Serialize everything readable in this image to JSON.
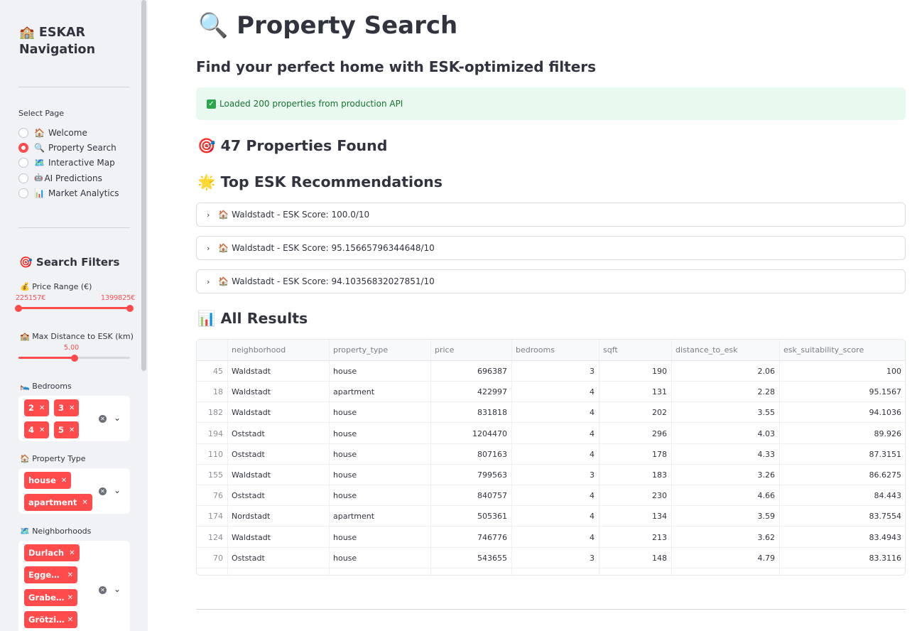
{
  "sidebar": {
    "title_line1": "🏫 ESKAR",
    "title_line2": "Navigation",
    "select_page_label": "Select Page",
    "pages": [
      {
        "icon": "🏠",
        "label": "Welcome",
        "selected": false
      },
      {
        "icon": "🔍",
        "label": "Property Search",
        "selected": true
      },
      {
        "icon": "🗺️",
        "label": "Interactive Map",
        "selected": false
      },
      {
        "icon": "🤖",
        "label": "AI Predictions",
        "selected": false
      },
      {
        "icon": "📊",
        "label": "Market Analytics",
        "selected": false
      }
    ],
    "filters_heading": "🎯 Search Filters",
    "price_label": "💰 Price Range (€)",
    "price_min": "225157€",
    "price_max": "1399825€",
    "distance_label": "🏫 Max Distance to ESK (km)",
    "distance_value": "5.00",
    "distance_fraction": 0.5,
    "bedrooms_label": "🛌 Bedrooms",
    "bedrooms": [
      "2",
      "3",
      "4",
      "5"
    ],
    "property_type_label": "🏠 Property Type",
    "property_types": [
      "house",
      "apartment"
    ],
    "neighborhoods_label": "🗺️ Neighborhoods",
    "neighborhoods": [
      "Durlach",
      "Egge…",
      "Grabe…",
      "Grötzi…"
    ]
  },
  "main": {
    "title": "🔍 Property Search",
    "subtitle": "Find your perfect home with ESK-optimized filters",
    "alert": "Loaded 200 properties from production API",
    "found_heading": "🎯 47 Properties Found",
    "recommendations_heading": "🌟 Top ESK Recommendations",
    "recommendations": [
      "🏠 Waldstadt - ESK Score: 100.0/10",
      "🏠 Waldstadt - ESK Score: 95.15665796344648/10",
      "🏠 Waldstadt - ESK Score: 94.10356832027851/10"
    ],
    "results_heading": "📊 All Results"
  },
  "table": {
    "columns": [
      "",
      "neighborhood",
      "property_type",
      "price",
      "bedrooms",
      "sqft",
      "distance_to_esk",
      "esk_suitability_score"
    ],
    "rows": [
      [
        "45",
        "Waldstadt",
        "house",
        "696387",
        "3",
        "190",
        "2.06",
        "100"
      ],
      [
        "18",
        "Waldstadt",
        "apartment",
        "422997",
        "4",
        "131",
        "2.28",
        "95.1567"
      ],
      [
        "182",
        "Waldstadt",
        "house",
        "831818",
        "4",
        "202",
        "3.55",
        "94.1036"
      ],
      [
        "194",
        "Oststadt",
        "house",
        "1204470",
        "4",
        "296",
        "4.03",
        "89.926"
      ],
      [
        "110",
        "Oststadt",
        "house",
        "807163",
        "4",
        "178",
        "4.33",
        "87.3151"
      ],
      [
        "155",
        "Waldstadt",
        "house",
        "799563",
        "3",
        "183",
        "3.26",
        "86.6275"
      ],
      [
        "76",
        "Oststadt",
        "house",
        "840757",
        "4",
        "230",
        "4.66",
        "84.443"
      ],
      [
        "174",
        "Nordstadt",
        "apartment",
        "505361",
        "4",
        "134",
        "3.59",
        "83.7554"
      ],
      [
        "124",
        "Waldstadt",
        "house",
        "746776",
        "4",
        "213",
        "3.62",
        "83.4943"
      ],
      [
        "70",
        "Oststadt",
        "house",
        "543655",
        "3",
        "148",
        "4.79",
        "83.3116"
      ]
    ]
  },
  "colors": {
    "accent": "#ff4b4b",
    "success_bg": "#e9f9ef",
    "success_text": "#177233"
  }
}
